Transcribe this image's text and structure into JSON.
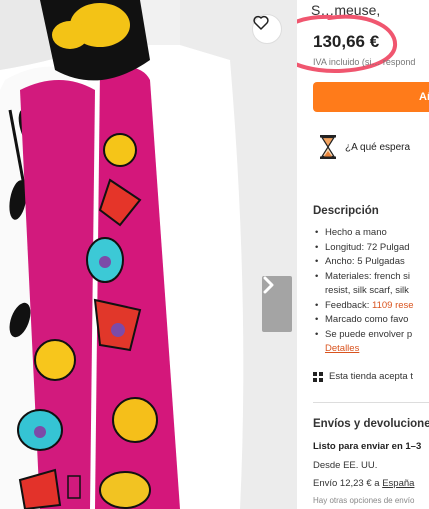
{
  "listing": {
    "title_fragment": "S…meuse,",
    "price": "130,66 €",
    "vat_note": "IVA incluido (si… respond",
    "add_to_cart_label": "Añ",
    "shipping_question": "¿A qué espera",
    "description": {
      "heading": "Descripción",
      "items": [
        "Hecho a mano",
        "Longitud: 72 Pulgad",
        "Ancho: 5 Pulgadas",
        "Materiales: french si",
        "Feedback:",
        "Marcado como favo",
        "Se puede envolver p"
      ],
      "materials_continued": "resist, silk scarf, silk",
      "feedback_count": "1109 rese",
      "details_link": "Detalles"
    },
    "payments_note": "Esta tienda acepta t",
    "shipping": {
      "heading": "Envíos y devolucione",
      "ready": "Listo para enviar en 1–3",
      "from": "Desde EE. UU.",
      "cost": "Envío 12,23 € a",
      "destination": "España",
      "other_options": "Hay otras opciones de envío"
    }
  },
  "icons": {
    "favorite": "heart-icon",
    "next": "chevron-right-icon",
    "hourglass": "hourglass-icon",
    "payments": "payment-grid-icon"
  },
  "colors": {
    "accent": "#ff7b1a",
    "link": "#d9531e",
    "annotation": "#f0566f"
  }
}
